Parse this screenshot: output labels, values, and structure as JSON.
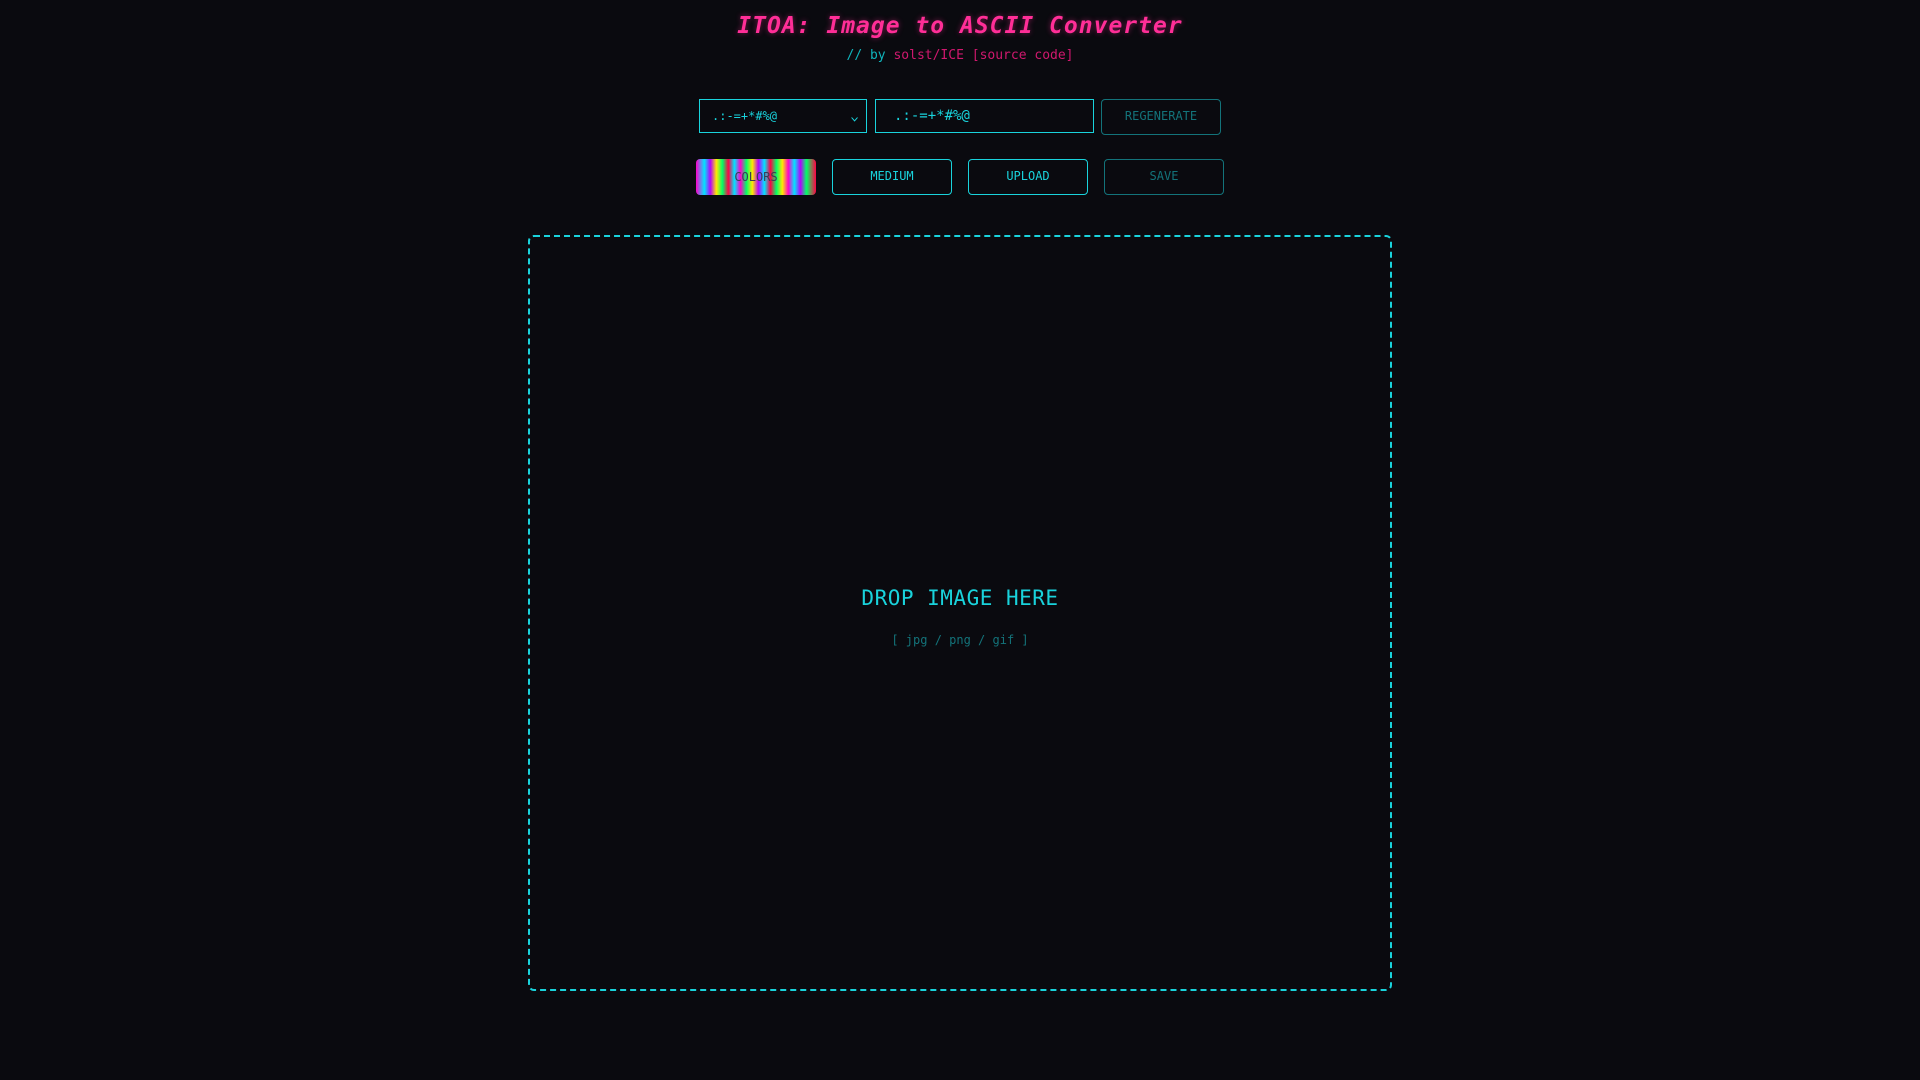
{
  "header": {
    "title": "ITOA: Image to ASCII Converter",
    "subtitle_prefix": "// by",
    "author": "solst/ICE",
    "source_link": "[source code]"
  },
  "controls": {
    "charset_select": {
      "selected": ".:-=+*#%@",
      "chevron_icon": "chevron-down-icon"
    },
    "charset_input_value": ".:-=+*#%@",
    "regenerate_label": "REGENERATE",
    "colors_label": "COLORS",
    "size_label": "MEDIUM",
    "upload_label": "UPLOAD",
    "save_label": "SAVE"
  },
  "dropzone": {
    "title": "DROP IMAGE HERE",
    "hint": "[ jpg / png / gif ]"
  },
  "colors": {
    "background": "#0a0a0f",
    "accent_cyan": "#19d3dc",
    "accent_pink": "#ff2e97"
  }
}
